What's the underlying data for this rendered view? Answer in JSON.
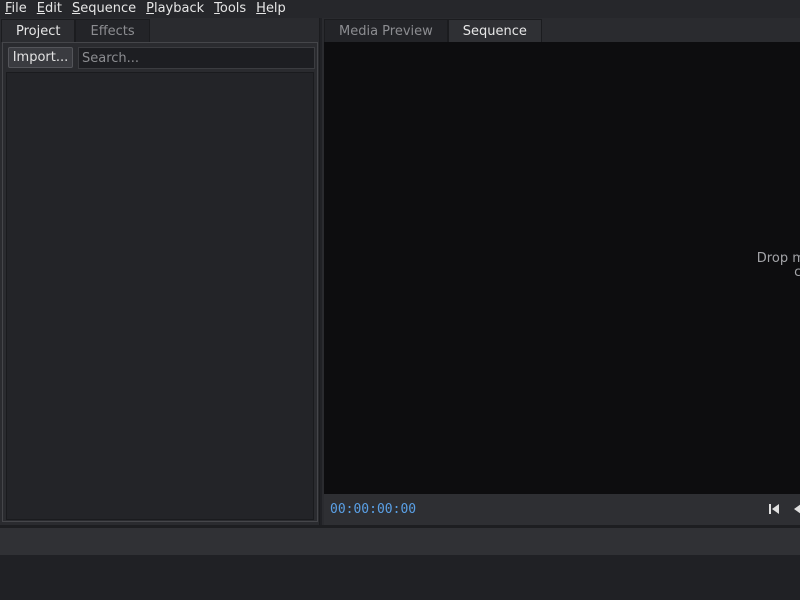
{
  "menubar": {
    "items": [
      {
        "accel": "F",
        "rest": "ile"
      },
      {
        "accel": "E",
        "rest": "dit"
      },
      {
        "accel": "S",
        "rest": "equence"
      },
      {
        "accel": "P",
        "rest": "layback"
      },
      {
        "accel": "T",
        "rest": "ools"
      },
      {
        "accel": "H",
        "rest": "elp"
      }
    ]
  },
  "left_panel": {
    "tabs": [
      "Project",
      "Effects"
    ],
    "active_tab": "Project",
    "import_label": "Import...",
    "search_placeholder": "Search..."
  },
  "right_panel": {
    "tabs": [
      "Media Preview",
      "Sequence"
    ],
    "active_tab": "Sequence",
    "drop_line1": "Drop media into the",
    "drop_line2": "clip from the pro",
    "timecode": "00:00:00:00"
  },
  "colors": {
    "accent_timecode": "#5aa0e6",
    "viewer_bg": "#0d0d0f",
    "panel_bg": "#2a2b2f"
  },
  "icons": {
    "go_to_start": "skip-to-start-icon",
    "step_back": "step-back-icon"
  }
}
